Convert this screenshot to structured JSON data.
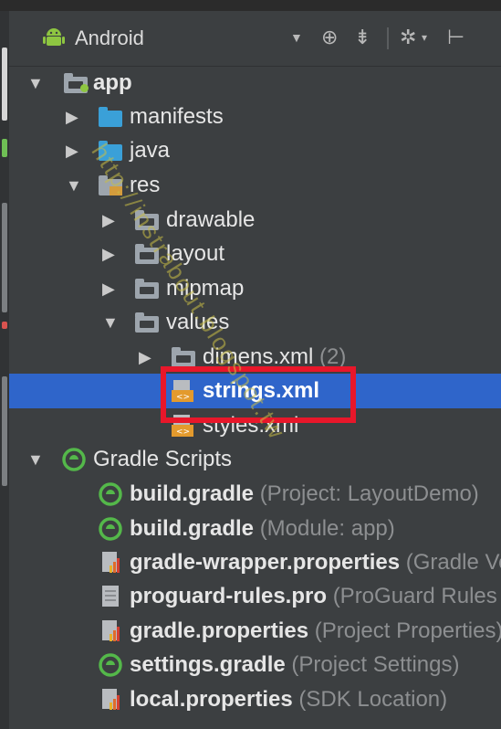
{
  "toolbar": {
    "view_label": "Android",
    "icons": [
      "dropdown-arrow-icon",
      "target-icon",
      "collapse-icon",
      "gear-icon",
      "hide-panel-icon"
    ]
  },
  "tree": {
    "app": "app",
    "manifests": "manifests",
    "java": "java",
    "res": "res",
    "drawable": "drawable",
    "layout": "layout",
    "mipmap": "mipmap",
    "values": "values",
    "dimens": "dimens.xml",
    "dimens_count": "(2)",
    "strings": "strings.xml",
    "styles": "styles.xml",
    "gradle_scripts": "Gradle Scripts",
    "gradle_files": [
      {
        "name": "build.gradle",
        "hint": "(Project: LayoutDemo)"
      },
      {
        "name": "build.gradle",
        "hint": "(Module: app)"
      },
      {
        "name": "gradle-wrapper.properties",
        "hint": "(Gradle Version)"
      },
      {
        "name": "proguard-rules.pro",
        "hint": "(ProGuard Rules for app)"
      },
      {
        "name": "gradle.properties",
        "hint": "(Project Properties)"
      },
      {
        "name": "settings.gradle",
        "hint": "(Project Settings)"
      },
      {
        "name": "local.properties",
        "hint": "(SDK Location)"
      }
    ]
  },
  "watermark": "http://instrabout.blogspot.tw",
  "colors": {
    "panel_bg": "#3c3f41",
    "selection": "#2f65ca",
    "highlight_box": "#e8172a",
    "folder_blue": "#3aa0d8",
    "folder_gray": "#9da5ad",
    "gradle_green": "#54b84a"
  }
}
